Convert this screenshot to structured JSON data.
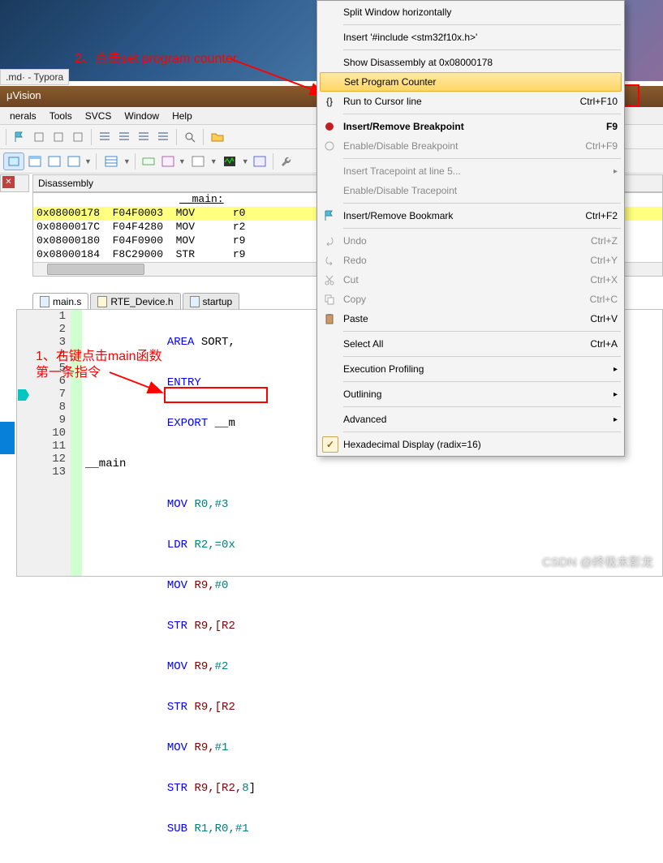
{
  "editor_tab": ".md· - Typora",
  "title": "μVision",
  "menu": {
    "m1": "nerals",
    "m2": "Tools",
    "m3": "SVCS",
    "m4": "Window",
    "m5": "Help"
  },
  "disasm": {
    "header": "Disassembly",
    "main_label": "__main:",
    "lines": [
      "0x08000178  F04F0003  MOV      r0",
      "0x0800017C  F04F4280  MOV      r2",
      "0x08000180  F04F0900  MOV      r9",
      "0x08000184  F8C29000  STR      r9"
    ]
  },
  "tabs": {
    "t1": "main.s",
    "t2": "RTE_Device.h",
    "t3": "startup"
  },
  "code": {
    "ln": [
      "1",
      "2",
      "3",
      "4",
      "5",
      "6",
      "7",
      "8",
      "9",
      "10",
      "11",
      "12",
      "13"
    ],
    "l1a": "AREA",
    "l1b": " SORT,",
    "l2": "ENTRY",
    "l3a": "EXPORT",
    "l3b": " __m",
    "l4": "__main",
    "l5a": "MOV",
    "l5b": " R0,",
    "l5c": "#3",
    "l6a": "LDR",
    "l6b": " R2,",
    "l6c": "=0x",
    "l7a": "MOV",
    "l7b": " R9,",
    "l7c": "#0",
    "l8a": "STR",
    "l8b": " R9,[R2",
    "l9a": "MOV",
    "l9b": " R9,",
    "l9c": "#2",
    "l10a": "STR",
    "l10b": " R9,[R2",
    "l11a": "MOV",
    "l11b": " R9,",
    "l11c": "#1",
    "l12a": "STR",
    "l12b": " R9,[R2,",
    "l12c": "8",
    "l12d": "]",
    "l13a": "SUB",
    "l13b": " R1,R0,",
    "l13c": "#1"
  },
  "cm": {
    "split": "Split Window horizontally",
    "insert": "Insert '#include <stm32f10x.h>'",
    "showdis": "Show Disassembly at 0x08000178",
    "setpc": "Set Program Counter",
    "runto": "Run to Cursor line",
    "runto_k": "Ctrl+F10",
    "bp": "Insert/Remove Breakpoint",
    "bp_k": "F9",
    "enbp": "Enable/Disable Breakpoint",
    "enbp_k": "Ctrl+F9",
    "instp": "Insert Tracepoint at line 5...",
    "entp": "Enable/Disable Tracepoint",
    "bm": "Insert/Remove Bookmark",
    "bm_k": "Ctrl+F2",
    "undo": "Undo",
    "undo_k": "Ctrl+Z",
    "redo": "Redo",
    "redo_k": "Ctrl+Y",
    "cut": "Cut",
    "cut_k": "Ctrl+X",
    "copy": "Copy",
    "copy_k": "Ctrl+C",
    "paste": "Paste",
    "paste_k": "Ctrl+V",
    "selall": "Select All",
    "selall_k": "Ctrl+A",
    "exec": "Execution Profiling",
    "outline": "Outlining",
    "adv": "Advanced",
    "hex": "Hexadecimal Display (radix=16)"
  },
  "annot1": "2、点击set program counter",
  "annot2a": "1、右键点击main函数",
  "annot2b": "第一条指令",
  "watermark": "CSDN @终极末影龙"
}
